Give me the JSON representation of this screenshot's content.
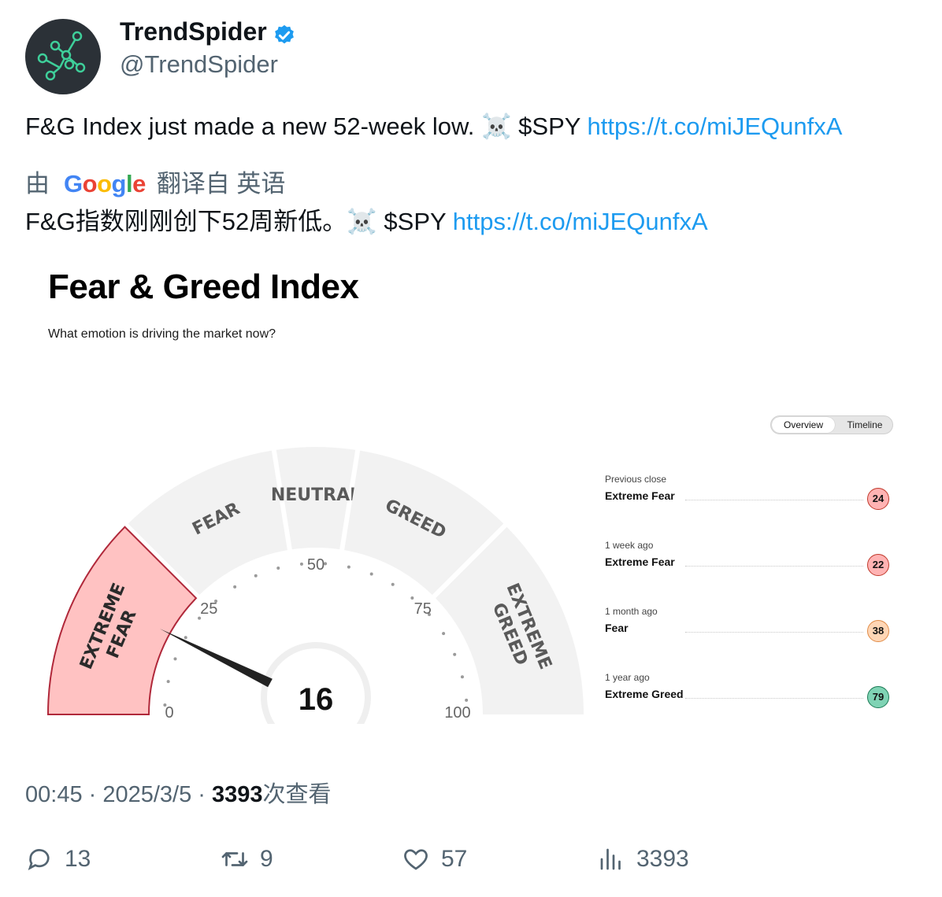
{
  "author": {
    "name": "TrendSpider",
    "handle": "@TrendSpider"
  },
  "tweet": {
    "text": "F&G Index just made a new 52-week low. ☠️  $SPY ",
    "link": "https://t.co/miJEQunfxA",
    "translate_prefix": "由",
    "translate_google": [
      "G",
      "o",
      "o",
      "g",
      "l",
      "e"
    ],
    "translate_suffix": "翻译自 英语",
    "translated_text": "F&G指数刚刚创下52周新低。☠️ $SPY ",
    "translated_link": "https://t.co/miJEQunfxA"
  },
  "card": {
    "title": "Fear & Greed Index",
    "subtitle": "What emotion is driving the market now?",
    "toggle": {
      "active": "Overview",
      "other": "Timeline"
    },
    "gauge": {
      "value": 16,
      "min": 0,
      "max": 100,
      "ticks": [
        "0",
        "25",
        "50",
        "75",
        "100"
      ],
      "zones": [
        {
          "label": "EXTREME FEAR",
          "from": 0,
          "to": 25,
          "active": true
        },
        {
          "label": "FEAR",
          "from": 25,
          "to": 45,
          "active": false
        },
        {
          "label": "NEUTRAL",
          "from": 45,
          "to": 55,
          "active": false
        },
        {
          "label": "GREED",
          "from": 55,
          "to": 75,
          "active": false
        },
        {
          "label": "EXTREME GREED",
          "from": 75,
          "to": 100,
          "active": false
        }
      ],
      "active_color": "#ffc2c2",
      "inactive_color": "#f2f2f2"
    },
    "history": [
      {
        "when": "Previous close",
        "label": "Extreme Fear",
        "value": "24",
        "class": "badge-ext-fear"
      },
      {
        "when": "1 week ago",
        "label": "Extreme Fear",
        "value": "22",
        "class": "badge-ext-fear"
      },
      {
        "when": "1 month ago",
        "label": "Fear",
        "value": "38",
        "class": "badge-fear"
      },
      {
        "when": "1 year ago",
        "label": "Extreme Greed",
        "value": "79",
        "class": "badge-ext-greed"
      }
    ]
  },
  "meta": {
    "time": "00:45",
    "date": "2025/3/5",
    "views": "3393",
    "views_suffix": "次查看"
  },
  "actions": {
    "replies": "13",
    "retweets": "9",
    "likes": "57",
    "views": "3393"
  }
}
